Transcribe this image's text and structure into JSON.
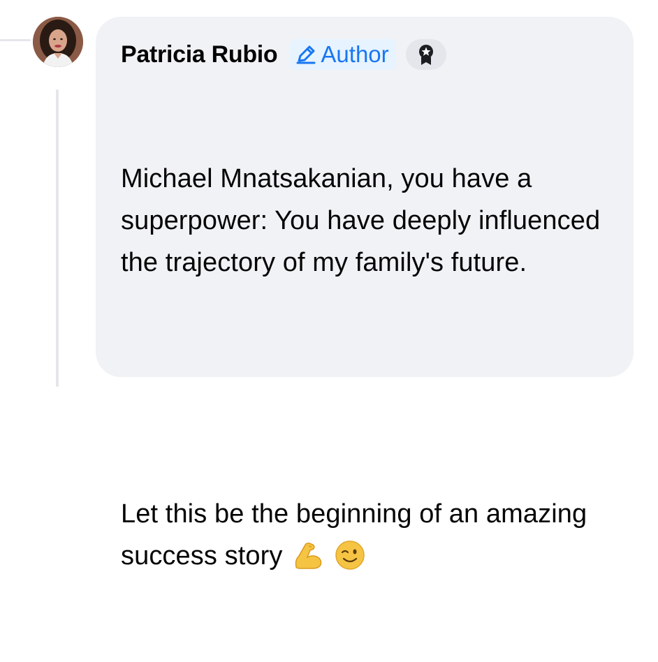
{
  "comment": {
    "author_name": "Patricia Rubio",
    "author_badge_label": "Author",
    "paragraphs": [
      "Michael Mnatsakanian, you have a superpower: You have deeply influenced the trajectory of my family's future.",
      "Let this be the beginning of an amazing success story"
    ],
    "emojis": [
      "flexed-biceps",
      "winking-face"
    ]
  },
  "colors": {
    "bubble_bg": "#f0f2f5",
    "badge_bg": "#e7f3ff",
    "badge_text": "#1877f2",
    "thread_line": "#e4e6eb",
    "text": "#050505"
  }
}
